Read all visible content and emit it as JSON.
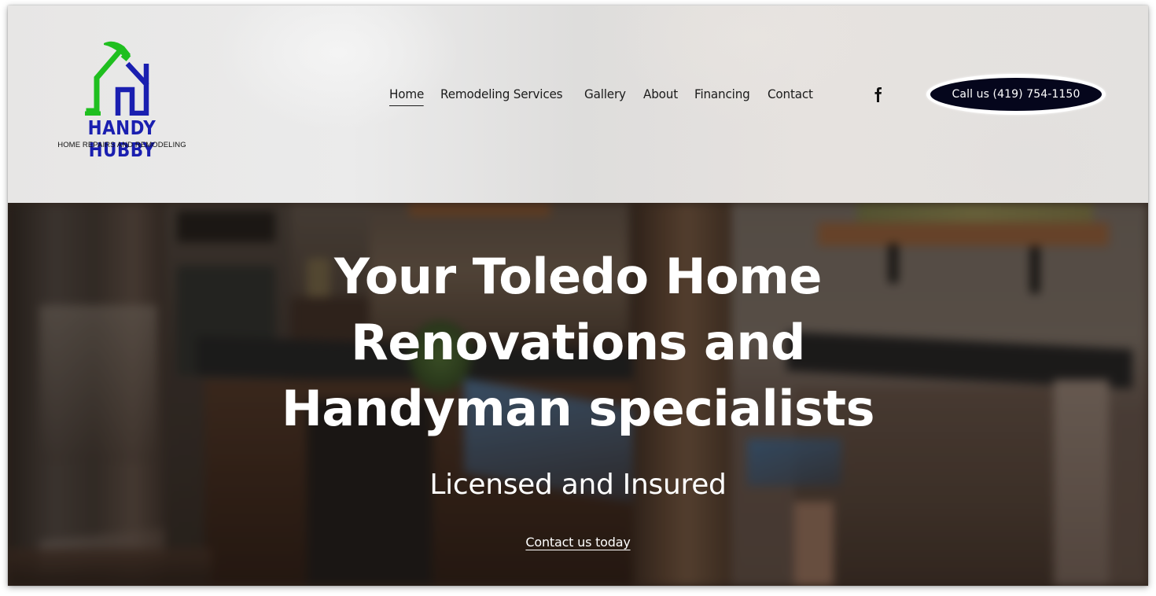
{
  "brand": {
    "name": "HANDY HUBBY",
    "tagline": "HOME REPAIRS AND REMODELING",
    "colors": {
      "green": "#1fbf1f",
      "blue": "#1a1fb0"
    }
  },
  "nav": {
    "items": [
      {
        "label": "Home",
        "active": true
      },
      {
        "label": "Remodeling Services",
        "active": false
      },
      {
        "label": "Gallery",
        "active": false
      },
      {
        "label": "About",
        "active": false
      },
      {
        "label": "Financing",
        "active": false
      },
      {
        "label": "Contact",
        "active": false
      }
    ],
    "social_icon": "facebook-icon"
  },
  "cta": {
    "call_label": "Call us (419) 754-1150",
    "color": "#05061c"
  },
  "hero": {
    "title_lines": [
      "Your Toledo Home",
      "Renovations and",
      "Handyman specialists"
    ],
    "subtitle": "Licensed and Insured",
    "link_label": "Contact us today"
  }
}
